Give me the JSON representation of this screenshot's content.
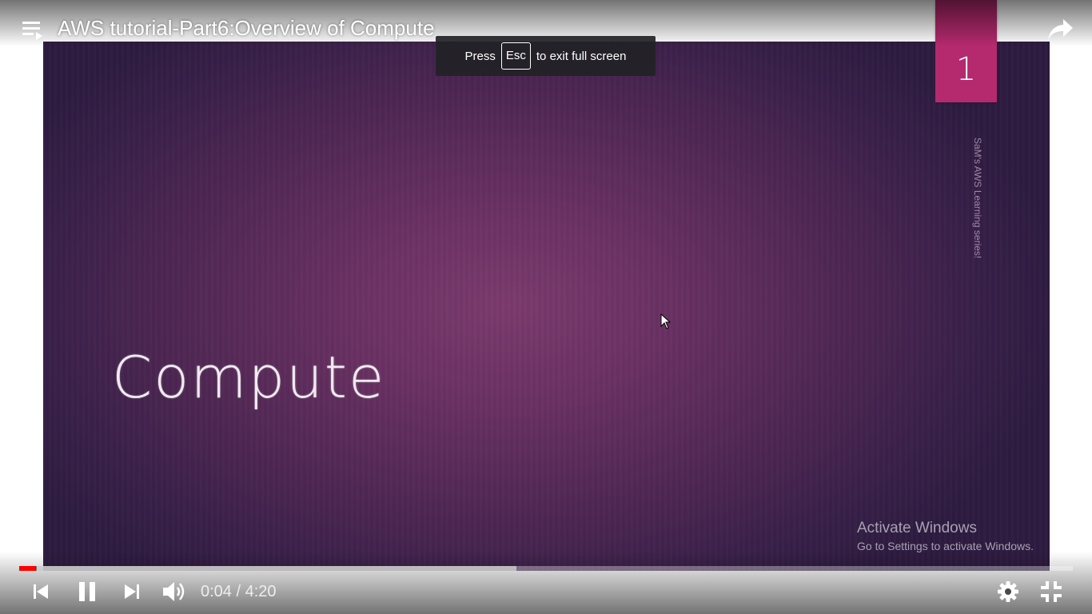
{
  "video": {
    "title": "AWS tutorial-Part6:Overview of Compute"
  },
  "slide": {
    "heading": "Compute",
    "vertical_caption": "SaM's AWS Learning series!",
    "page_number": "1",
    "accent_color": "#b52a6e"
  },
  "notification": {
    "prefix": "Press",
    "key": "Esc",
    "suffix": "to exit full screen"
  },
  "watermark": {
    "title": "Activate Windows",
    "subtitle": "Go to Settings to activate Windows."
  },
  "player": {
    "current_time": "0:04",
    "separator": "/",
    "duration": "4:20",
    "progress_played_fraction": 0.016,
    "progress_buffered_fraction": 0.472,
    "progress_color": "#ff0000",
    "icons": {
      "playlist": "playlist-icon",
      "share": "share-icon",
      "previous": "previous-icon",
      "pause": "pause-icon",
      "next": "next-icon",
      "volume": "volume-icon",
      "settings": "gear-icon",
      "exit_fullscreen": "exit-fullscreen-icon"
    }
  }
}
